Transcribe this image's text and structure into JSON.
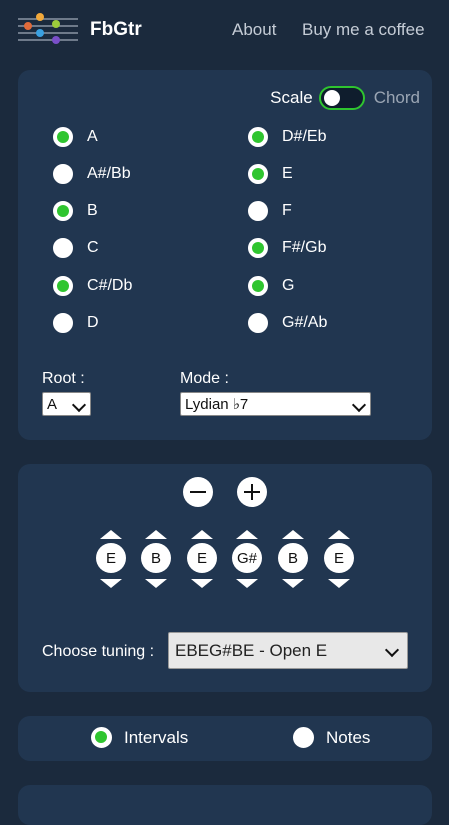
{
  "navbar": {
    "brand": "FbGtr",
    "links": [
      "About",
      "Buy me a coffee"
    ]
  },
  "mode_toggle": {
    "left_label": "Scale",
    "right_label": "Chord",
    "selected": "Scale"
  },
  "notes": [
    {
      "label": "A",
      "checked": true
    },
    {
      "label": "A#/Bb",
      "checked": false
    },
    {
      "label": "B",
      "checked": true
    },
    {
      "label": "C",
      "checked": false
    },
    {
      "label": "C#/Db",
      "checked": true
    },
    {
      "label": "D",
      "checked": false
    },
    {
      "label": "D#/Eb",
      "checked": true
    },
    {
      "label": "E",
      "checked": true
    },
    {
      "label": "F",
      "checked": false
    },
    {
      "label": "F#/Gb",
      "checked": true
    },
    {
      "label": "G",
      "checked": true
    },
    {
      "label": "G#/Ab",
      "checked": false
    }
  ],
  "root": {
    "label": "Root :",
    "value": "A"
  },
  "mode": {
    "label": "Mode :",
    "value": "Lydian ♭7"
  },
  "strings": [
    "E",
    "B",
    "E",
    "G#",
    "B",
    "E"
  ],
  "tuning": {
    "label": "Choose tuning :",
    "value": "EBEG#BE - Open E"
  },
  "display_mode": {
    "options": [
      "Intervals",
      "Notes"
    ],
    "selected": "Intervals"
  },
  "colors": {
    "background": "#1b2a3d",
    "card": "#213650",
    "accent": "#2fc52f"
  }
}
